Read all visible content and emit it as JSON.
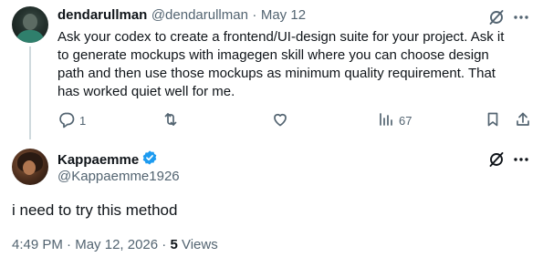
{
  "tweet": {
    "author_name": "dendarullman",
    "author_handle": "@dendarullman",
    "separator": "·",
    "date": "May 12",
    "text": "Ask your codex to create a frontend/UI-design suite for your project. Ask it to generate mockups with imagegen skill where you can choose design path and then use those mockups as minimum quality requirement. That has worked quiet well for me.",
    "actions": {
      "reply_count": "1",
      "views_count": "67"
    },
    "icons": [
      "grok-icon",
      "more-icon",
      "reply-icon",
      "retweet-icon",
      "like-icon",
      "views-icon",
      "bookmark-icon",
      "share-icon"
    ]
  },
  "reply": {
    "author_name": "Kappaemme",
    "author_handle": "@Kappaemme1926",
    "verified": true,
    "text": "i need to try this method",
    "time": "4:49 PM",
    "date": "May 12, 2026",
    "separator1": "·",
    "separator2": "·",
    "views_count": "5",
    "views_label": "Views"
  },
  "colors": {
    "text": "#0f1419",
    "muted": "#536471",
    "verified_blue": "#1d9bf0",
    "thread_line": "#cfd9de"
  }
}
